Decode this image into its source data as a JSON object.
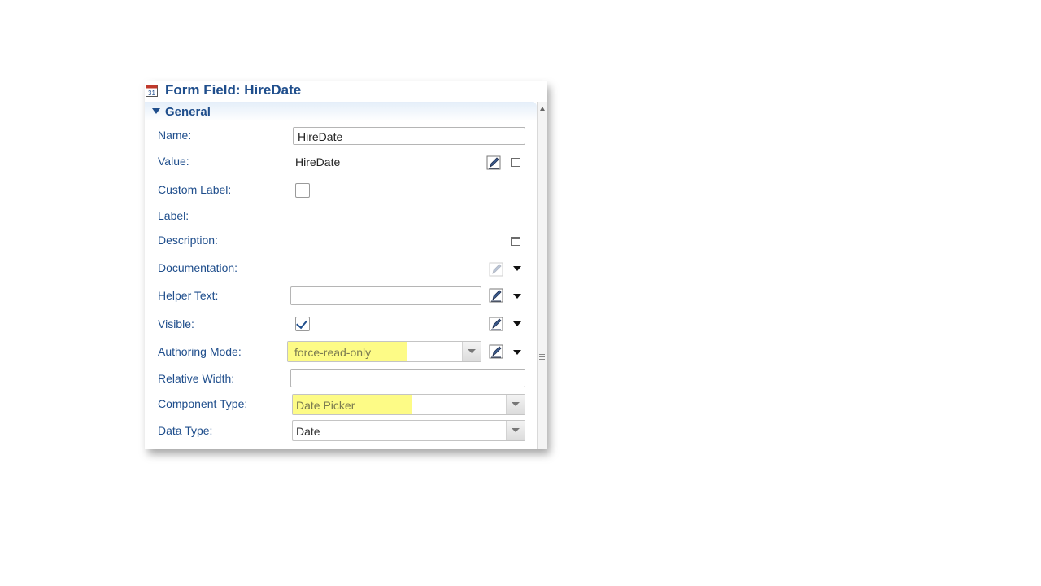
{
  "title": "Form Field: HireDate",
  "section": {
    "title": "General",
    "expanded": true
  },
  "fields": {
    "name": {
      "label": "Name:",
      "value": "HireDate"
    },
    "value": {
      "label": "Value:",
      "value": "HireDate"
    },
    "custom_label": {
      "label": "Custom Label:",
      "checked": false
    },
    "label": {
      "label": "Label:"
    },
    "description": {
      "label": "Description:"
    },
    "documentation": {
      "label": "Documentation:"
    },
    "helper_text": {
      "label": "Helper Text:",
      "value": ""
    },
    "visible": {
      "label": "Visible:",
      "checked": true
    },
    "authoring_mode": {
      "label": "Authoring Mode:",
      "value": "force-read-only"
    },
    "relative_width": {
      "label": "Relative Width:",
      "value": ""
    },
    "component_type": {
      "label": "Component Type:",
      "value": "Date Picker"
    },
    "data_type": {
      "label": "Data Type:",
      "value": "Date"
    }
  },
  "colors": {
    "label": "#1f4e8c",
    "highlight": "#fdfb86"
  },
  "icons": [
    "calendar-icon",
    "edit-icon",
    "window-icon",
    "dropdown-arrow-icon",
    "check-icon"
  ]
}
